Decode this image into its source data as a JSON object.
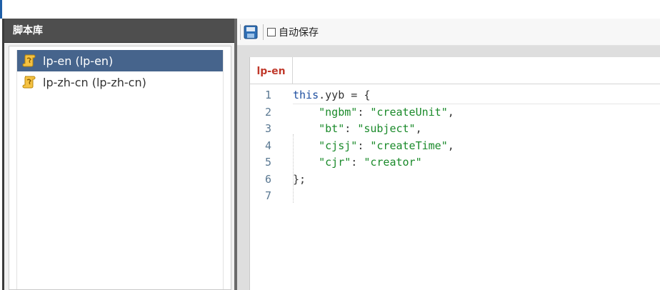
{
  "left_panel": {
    "title": "脚本库",
    "items": [
      {
        "label": "lp-en (lp-en)",
        "icon": "script-scroll-icon",
        "selected": true
      },
      {
        "label": "lp-zh-cn (lp-zh-cn)",
        "icon": "script-scroll-icon",
        "selected": false
      }
    ]
  },
  "toolbar": {
    "save_icon": "save-icon",
    "autosave_label": "自动保存",
    "autosave_checked": false
  },
  "editor": {
    "tab_label": "lp-en",
    "lines": [
      {
        "num": "1",
        "text": "this.yyb = {"
      },
      {
        "num": "2",
        "text": "    \"ngbm\": \"createUnit\","
      },
      {
        "num": "3",
        "text": "    \"bt\": \"subject\","
      },
      {
        "num": "4",
        "text": "    \"cjsj\": \"createTime\","
      },
      {
        "num": "5",
        "text": "    \"cjr\": \"creator\""
      },
      {
        "num": "6",
        "text": "};"
      },
      {
        "num": "7",
        "text": ""
      }
    ]
  },
  "colors": {
    "selected_bg": "#46648c",
    "header_bg": "#4e4e4e",
    "tab_text": "#c0392b",
    "keyword": "#1f4fa0",
    "string": "#1a8a2a",
    "line_number": "#5a7892"
  }
}
